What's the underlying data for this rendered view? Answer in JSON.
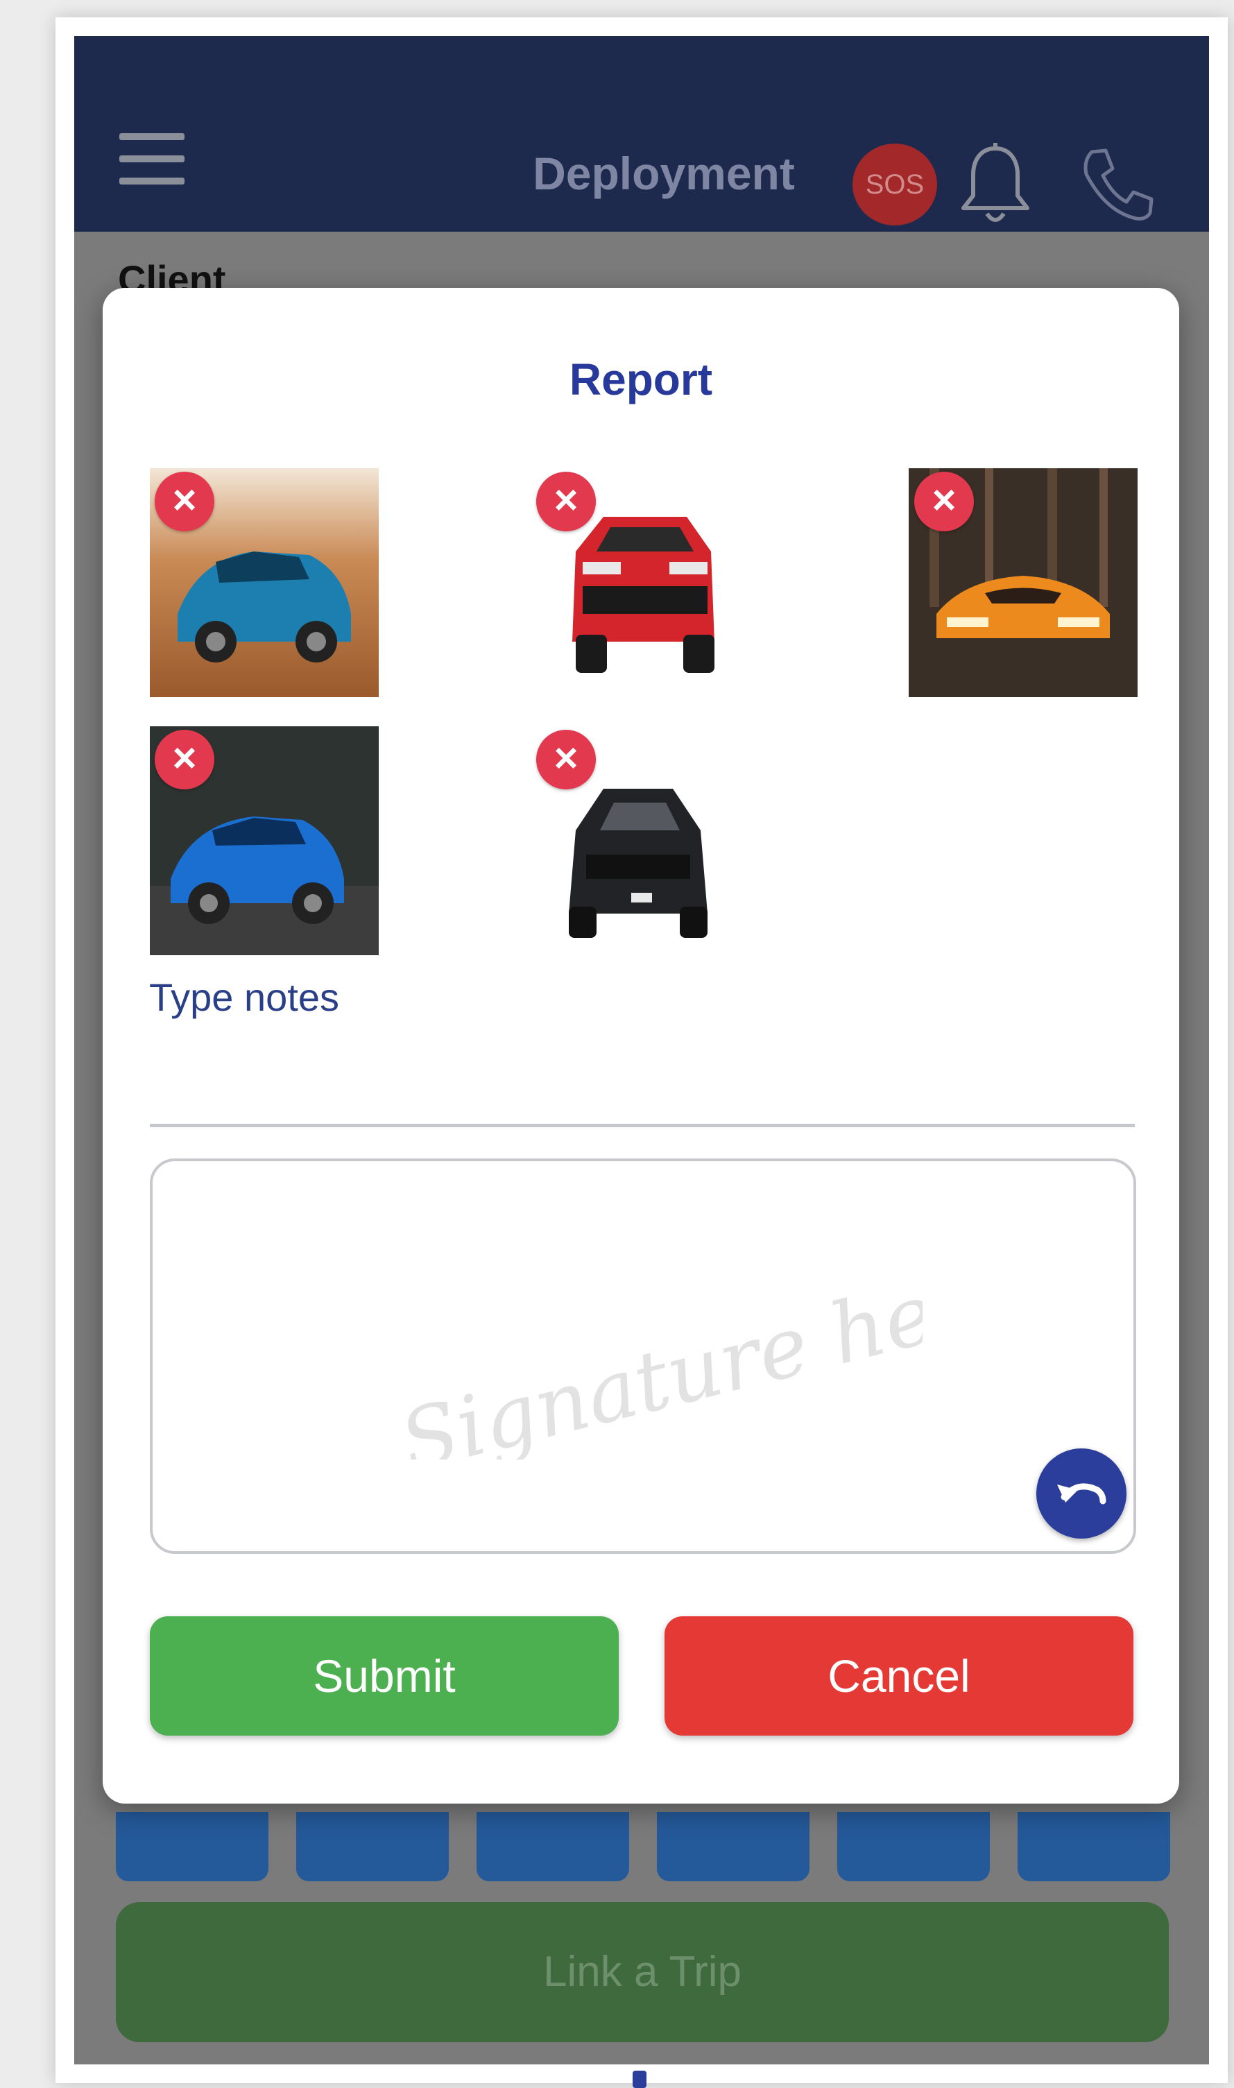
{
  "header": {
    "title": "Deployment",
    "sos_label": "SOS",
    "colors": {
      "bar": "#1d2a4e",
      "sos": "#a3282a"
    }
  },
  "background": {
    "client_label": "Client",
    "link_trip_label": "Link a Trip"
  },
  "modal": {
    "title": "Report",
    "photos": [
      {
        "subject": "blue SUV on desert dunes",
        "remove_icon": "close-icon"
      },
      {
        "subject": "red SUV front view",
        "remove_icon": "close-icon"
      },
      {
        "subject": "orange sports car in forest",
        "remove_icon": "close-icon"
      },
      {
        "subject": "blue SUV in forest",
        "remove_icon": "close-icon"
      },
      {
        "subject": "black SUV front view",
        "remove_icon": "close-icon"
      }
    ],
    "notes_placeholder": "Type notes",
    "signature_placeholder": "Signature here",
    "submit_label": "Submit",
    "cancel_label": "Cancel",
    "colors": {
      "title": "#27399a",
      "submit": "#4caf50",
      "cancel": "#e53935",
      "remove": "#e2394f",
      "undo": "#2b3e9b"
    }
  }
}
